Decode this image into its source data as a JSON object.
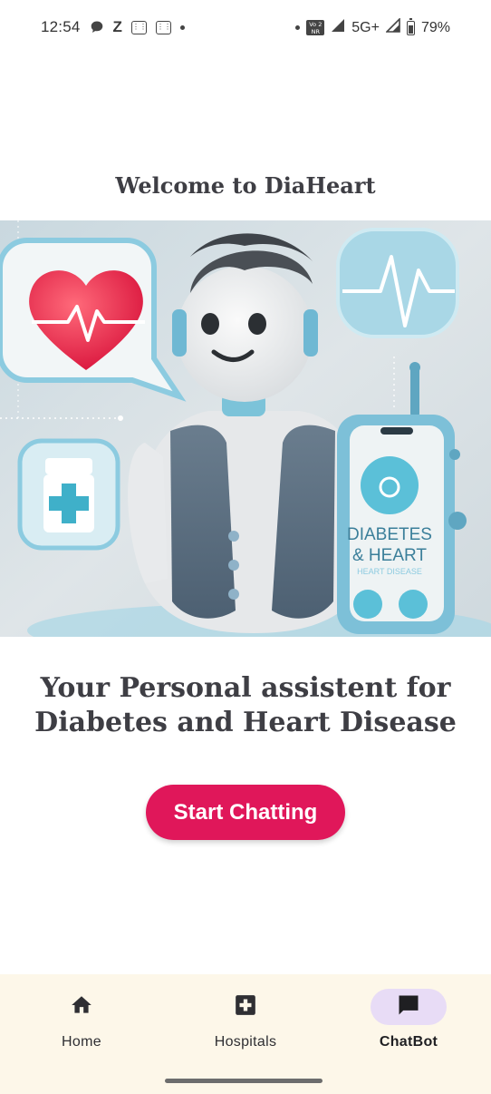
{
  "status_bar": {
    "time": "12:54",
    "network": "5G+",
    "battery": "79%",
    "volte": "Vo 2\nNR",
    "icons": [
      "chat-bubble-icon",
      "z-icon",
      "grid-icon",
      "grid-icon",
      "dot-icon",
      "dot-icon",
      "volte-icon",
      "signal-icon",
      "signal-icon",
      "battery-icon"
    ]
  },
  "main": {
    "welcome_title": "Welcome to DiaHeart",
    "hero_phone_text_1": "DIABETES",
    "hero_phone_text_2": "& HEART",
    "hero_phone_text_3": "HEART DISEASE",
    "tagline_line1": "Your Personal assistent for",
    "tagline_line2": "Diabetes and Heart Disease",
    "start_button": "Start Chatting"
  },
  "bottom_nav": {
    "items": [
      {
        "label": "Home",
        "icon": "home-icon",
        "active": false
      },
      {
        "label": "Hospitals",
        "icon": "medical-cross-icon",
        "active": false
      },
      {
        "label": "ChatBot",
        "icon": "chat-icon",
        "active": true
      }
    ]
  },
  "colors": {
    "accent": "#e0175a",
    "nav_background": "#fdf7e9",
    "active_pill": "#e8dcf6"
  }
}
